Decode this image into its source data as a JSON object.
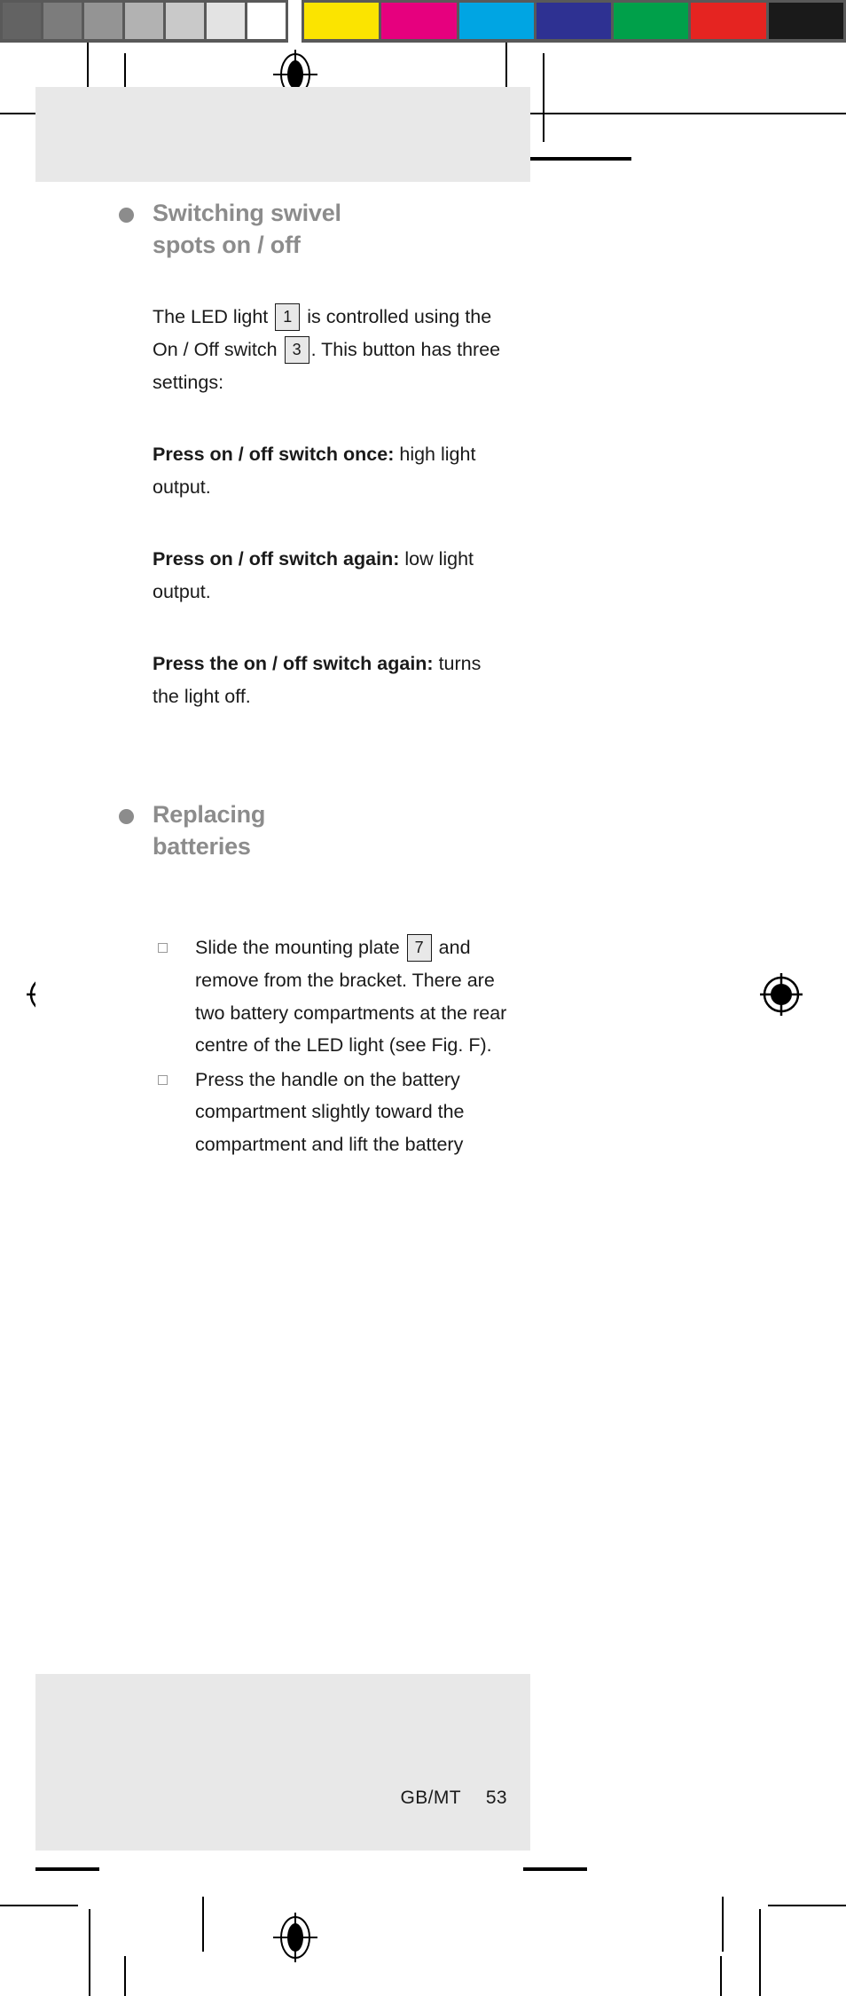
{
  "calibration": {
    "gray_bar_label": "grayscale-calibration-bar",
    "gray_swatches": [
      "#636363",
      "#7c7c7c",
      "#949494",
      "#b2b2b2",
      "#c9c9c9",
      "#e3e3e3",
      "#ffffff"
    ],
    "color_bar_label": "color-calibration-bar",
    "color_swatches": [
      "#fbe400",
      "#e6007e",
      "#00a5e3",
      "#2e3192",
      "#00a04a",
      "#e52421",
      "#1a1a1a"
    ],
    "bar_frame_color": "#595959"
  },
  "page": {
    "panel_color": "#e8e8e8",
    "body_color": "#1a1a1a",
    "heading_color": "#8c8c8c",
    "bullet_color": "#9a9a9a"
  },
  "sections": [
    {
      "heading_line1": "Switching swivel",
      "heading_line2": "spots on / off",
      "paragraphs": [
        {
          "kind": "rich",
          "parts": [
            {
              "t": "text",
              "v": "The LED light "
            },
            {
              "t": "ref",
              "v": "1"
            },
            {
              "t": "text",
              "v": " is controlled using the On / Off switch "
            },
            {
              "t": "ref",
              "v": "3"
            },
            {
              "t": "text",
              "v": ". This button has three settings:"
            }
          ]
        },
        {
          "kind": "lead",
          "lead": "Press on / off switch once:",
          "rest": " high light output."
        },
        {
          "kind": "lead",
          "lead": "Press on / off switch again:",
          "rest": " low light output."
        },
        {
          "kind": "lead",
          "lead": "Press the on / off switch again:",
          "rest": " turns the light off."
        }
      ]
    },
    {
      "heading_line1": "Replacing",
      "heading_line2": "batteries",
      "list": [
        {
          "parts": [
            {
              "t": "text",
              "v": "Slide the mounting plate "
            },
            {
              "t": "ref",
              "v": "7"
            },
            {
              "t": "text",
              "v": " and remove from the bracket. There are two battery compartments at the rear centre of the LED light (see Fig. F)."
            }
          ]
        },
        {
          "parts": [
            {
              "t": "text",
              "v": "Press the handle on the battery compartment slightly toward the compartment and lift the battery"
            }
          ]
        }
      ]
    }
  ],
  "footer": {
    "locale": "GB/MT",
    "page_number": "53"
  }
}
